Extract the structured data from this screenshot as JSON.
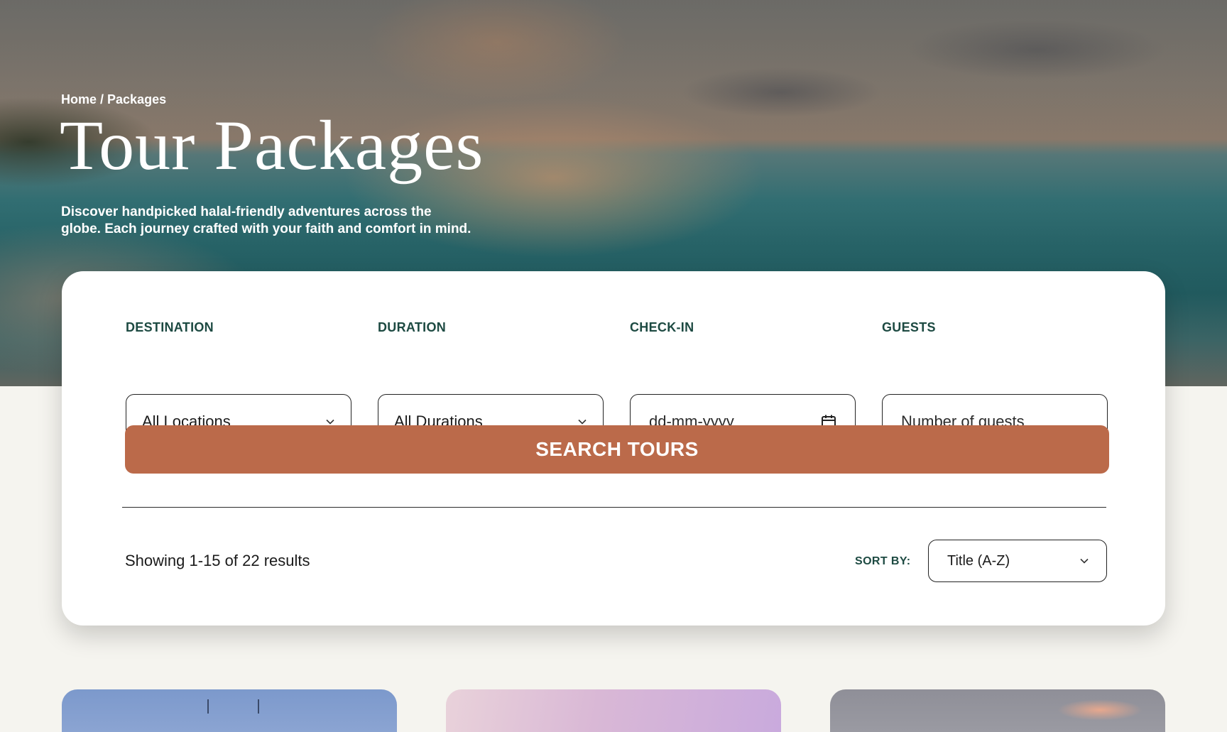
{
  "breadcrumb": {
    "home": "Home",
    "separator": "/",
    "current": "Packages"
  },
  "hero": {
    "title": "Tour Packages",
    "subtitle": "Discover handpicked halal-friendly adventures across the globe. Each journey crafted with your faith and comfort in mind."
  },
  "search": {
    "destination": {
      "label": "DESTINATION",
      "value": "All Locations",
      "icon": "chevron-down-icon"
    },
    "duration": {
      "label": "DURATION",
      "value": "All Durations",
      "icon": "chevron-down-icon"
    },
    "checkin": {
      "label": "CHECK-IN",
      "placeholder": "dd-mm-yyyy",
      "icon": "calendar-icon"
    },
    "guests": {
      "label": "GUESTS",
      "placeholder": "Number of guests"
    },
    "button_label": "SEARCH TOURS"
  },
  "results": {
    "count_text": "Showing 1-15 of 22 results",
    "sort_label": "SORT BY:",
    "sort_value": "Title (A-Z)"
  },
  "colors": {
    "accent": "#bb6a4a",
    "label_green": "#1d4a42",
    "page_background": "#f5f4ef"
  }
}
